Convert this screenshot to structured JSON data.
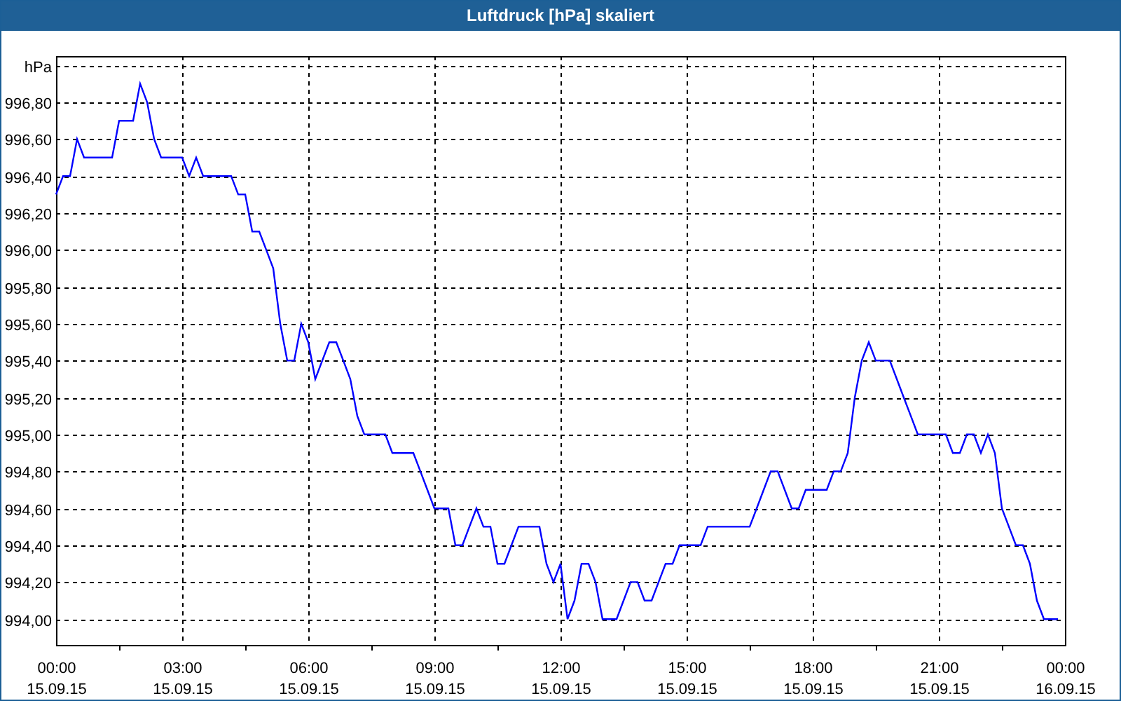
{
  "chart_data": {
    "type": "line",
    "title": "Luftdruck [hPa] skaliert",
    "grid": true,
    "ylim": [
      993.86,
      997.05
    ],
    "yticks": [
      {
        "value": 994,
        "label": "994,00"
      },
      {
        "value": 994.2,
        "label": "994,20"
      },
      {
        "value": 994.4,
        "label": "994,40"
      },
      {
        "value": 994.6,
        "label": "994,60"
      },
      {
        "value": 994.8,
        "label": "994,80"
      },
      {
        "value": 995,
        "label": "995,00"
      },
      {
        "value": 995.2,
        "label": "995,20"
      },
      {
        "value": 995.4,
        "label": "995,40"
      },
      {
        "value": 995.6,
        "label": "995,60"
      },
      {
        "value": 995.8,
        "label": "995,80"
      },
      {
        "value": 996,
        "label": "996,00"
      },
      {
        "value": 996.2,
        "label": "996,20"
      },
      {
        "value": 996.4,
        "label": "996,40"
      },
      {
        "value": 996.6,
        "label": "996,60"
      },
      {
        "value": 996.8,
        "label": "996,80"
      },
      {
        "value": 997,
        "label": "hPa"
      }
    ],
    "categories": [
      "00:00 15.09.15",
      null,
      null,
      null,
      null,
      null,
      null,
      null,
      null,
      null,
      null,
      null,
      null,
      null,
      null,
      null,
      null,
      null,
      "03:00 15.09.15",
      null,
      null,
      null,
      null,
      null,
      null,
      null,
      null,
      null,
      null,
      null,
      null,
      null,
      null,
      null,
      null,
      null,
      "06:00 15.09.15",
      null,
      null,
      null,
      null,
      null,
      null,
      null,
      null,
      null,
      null,
      null,
      null,
      null,
      null,
      null,
      null,
      null,
      "09:00 15.09.15",
      null,
      null,
      null,
      null,
      null,
      null,
      null,
      null,
      null,
      null,
      null,
      null,
      null,
      null,
      null,
      null,
      null,
      "12:00 15.09.15",
      null,
      null,
      null,
      null,
      null,
      null,
      null,
      null,
      null,
      null,
      null,
      null,
      null,
      null,
      null,
      null,
      null,
      "15:00 15.09.15",
      null,
      null,
      null,
      null,
      null,
      null,
      null,
      null,
      null,
      null,
      null,
      null,
      null,
      null,
      null,
      null,
      null,
      "18:00 15.09.15",
      null,
      null,
      null,
      null,
      null,
      null,
      null,
      null,
      null,
      null,
      null,
      null,
      null,
      null,
      null,
      null,
      null,
      "21:00 15.09.15",
      null,
      null,
      null,
      null,
      null,
      null,
      null,
      null,
      null,
      null,
      null,
      null,
      null,
      null,
      null,
      null,
      null,
      "00:00 16.09.15"
    ],
    "series": [
      {
        "color": "#0000ff",
        "values": [
          996.3,
          996.4,
          996.4,
          996.6,
          996.5,
          996.5,
          996.5,
          996.5,
          996.5,
          996.7,
          996.7,
          996.7,
          996.9,
          996.8,
          996.6,
          996.5,
          996.5,
          996.5,
          996.5,
          996.4,
          996.5,
          996.4,
          996.4,
          996.4,
          996.4,
          996.4,
          996.3,
          996.3,
          996.1,
          996.1,
          996.0,
          995.9,
          995.6,
          995.4,
          995.4,
          995.6,
          995.5,
          995.3,
          995.4,
          995.5,
          995.5,
          995.4,
          995.3,
          995.1,
          995.0,
          995.0,
          995.0,
          995.0,
          994.9,
          994.9,
          994.9,
          994.9,
          994.8,
          994.7,
          994.6,
          994.6,
          994.6,
          994.4,
          994.4,
          994.5,
          994.6,
          994.5,
          994.5,
          994.3,
          994.3,
          994.4,
          994.5,
          994.5,
          994.5,
          994.5,
          994.3,
          994.2,
          994.3,
          994.0,
          994.1,
          994.3,
          994.3,
          994.2,
          994.0,
          994.0,
          994.0,
          994.1,
          994.2,
          994.2,
          994.1,
          994.1,
          994.2,
          994.3,
          994.3,
          994.4,
          994.4,
          994.4,
          994.4,
          994.5,
          994.5,
          994.5,
          994.5,
          994.5,
          994.5,
          994.5,
          994.6,
          994.7,
          994.8,
          994.8,
          994.7,
          994.6,
          994.6,
          994.7,
          994.7,
          994.7,
          994.7,
          994.8,
          994.8,
          994.9,
          995.2,
          995.4,
          995.5,
          995.4,
          995.4,
          995.4,
          995.3,
          995.2,
          995.1,
          995.0,
          995.0,
          995.0,
          995.0,
          995.0,
          994.9,
          994.9,
          995.0,
          995.0,
          994.9,
          995.0,
          994.9,
          994.6,
          994.5,
          994.4,
          994.4,
          994.3,
          994.1,
          994.0,
          994.0,
          994.0,
          null
        ]
      }
    ]
  }
}
